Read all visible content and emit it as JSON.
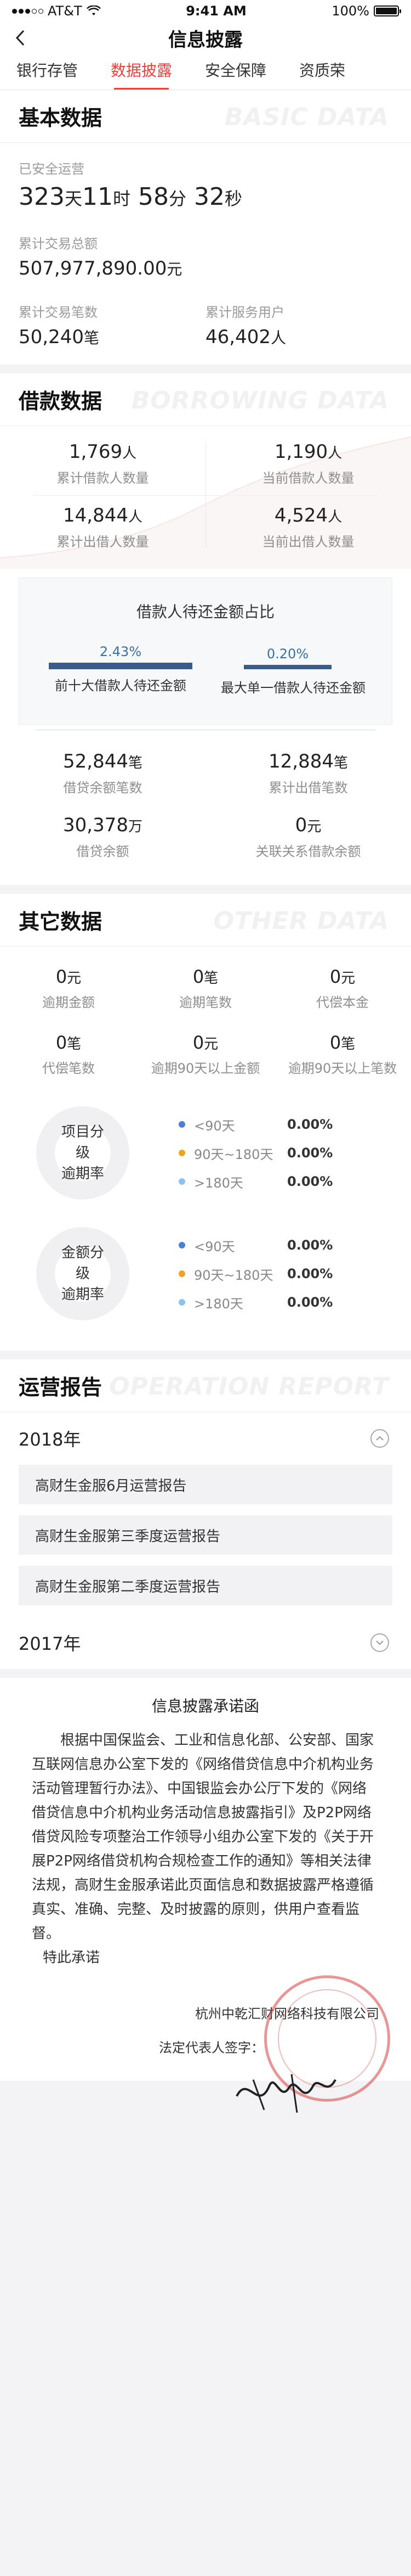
{
  "status_bar": {
    "carrier": "AT&T",
    "time": "9:41 AM",
    "battery": "100%"
  },
  "nav": {
    "title": "信息披露"
  },
  "tabs": [
    "银行存管",
    "数据披露",
    "安全保障",
    "资质荣"
  ],
  "basic": {
    "title": "基本数据",
    "title_en": "BASIC DATA",
    "safe_label": "已安全运营",
    "days": "323",
    "days_unit": "天",
    "hours": "11",
    "hours_unit": "时",
    "minutes": "58",
    "minutes_unit": "分",
    "seconds": "32",
    "seconds_unit": "秒",
    "total_label": "累计交易总额",
    "total_value": "507,977,890.00",
    "total_unit": "元",
    "count_label": "累计交易笔数",
    "count_value": "50,240",
    "count_unit": "笔",
    "users_label": "累计服务用户",
    "users_value": "46,402",
    "users_unit": "人"
  },
  "borrow": {
    "title": "借款数据",
    "title_en": "BORROWING DATA",
    "stats": [
      {
        "value": "1,769",
        "unit": "人",
        "label": "累计借款人数量"
      },
      {
        "value": "1,190",
        "unit": "人",
        "label": "当前借款人数量"
      },
      {
        "value": "14,844",
        "unit": "人",
        "label": "累计出借人数量"
      },
      {
        "value": "4,524",
        "unit": "人",
        "label": "当前出借人数量"
      }
    ],
    "ratio_title": "借款人待还金额占比",
    "ratio": [
      {
        "pct": "2.43%",
        "label": "前十大借款人待还金额"
      },
      {
        "pct": "0.20%",
        "label": "最大单一借款人待还金额"
      }
    ],
    "stats2": [
      {
        "value": "52,844",
        "unit": "笔",
        "label": "借贷余额笔数"
      },
      {
        "value": "12,884",
        "unit": "笔",
        "label": "累计出借笔数"
      },
      {
        "value": "30,378",
        "unit": "万",
        "label": "借贷余额"
      },
      {
        "value": "0",
        "unit": "元",
        "label": "关联关系借款余额"
      }
    ]
  },
  "other": {
    "title": "其它数据",
    "title_en": "OTHER DATA",
    "stats": [
      {
        "value": "0",
        "unit": "元",
        "label": "逾期金额"
      },
      {
        "value": "0",
        "unit": "笔",
        "label": "逾期笔数"
      },
      {
        "value": "0",
        "unit": "元",
        "label": "代偿本金"
      },
      {
        "value": "0",
        "unit": "笔",
        "label": "代偿笔数"
      },
      {
        "value": "0",
        "unit": "元",
        "label": "逾期90天以上金额"
      },
      {
        "value": "0",
        "unit": "笔",
        "label": "逾期90天以上笔数"
      }
    ],
    "donut1": {
      "line1": "项目分级",
      "line2": "逾期率"
    },
    "donut2": {
      "line1": "金额分级",
      "line2": "逾期率"
    },
    "legend": [
      {
        "name": "<90天",
        "pct": "0.00%",
        "color": "#4a7fd6"
      },
      {
        "name": "90天~180天",
        "pct": "0.00%",
        "color": "#f0a323"
      },
      {
        "name": ">180天",
        "pct": "0.00%",
        "color": "#8cc3ee"
      }
    ]
  },
  "report": {
    "title": "运营报告",
    "title_en": "OPERATION REPORT",
    "year1": "2018年",
    "items": [
      "高财生金服6月运营报告",
      "高财生金服第三季度运营报告",
      "高财生金服第二季度运营报告"
    ],
    "year2": "2017年"
  },
  "promise": {
    "title": "信息披露承诺函",
    "body": "根据中国保监会、工业和信息化部、公安部、国家互联网信息办公室下发的《网络借贷信息中介机构业务活动管理暂行办法》、中国银监会办公厅下发的《网络借贷信息中介机构业务活动信息披露指引》及P2P网络借贷风险专项整治工作领导小组办公室下发的《关于开展P2P网络借贷机构合规检查工作的通知》等相关法律法规，高财生金服承诺此页面信息和数据披露严格遵循真实、准确、完整、及时披露的原则，供用户查看监督。",
    "closing": "特此承诺",
    "company": "杭州中乾汇财网络科技有限公司",
    "rep_label": "法定代表人签字："
  }
}
